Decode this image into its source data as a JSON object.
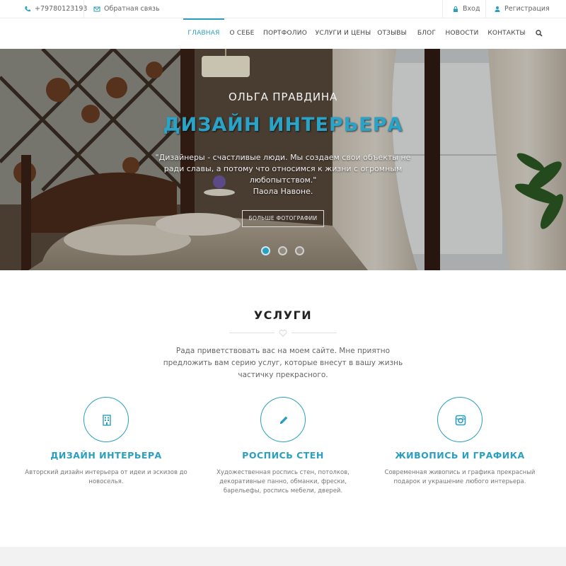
{
  "topbar": {
    "phone": "+79780123193",
    "feedback": "Обратная связь",
    "login": "Вход",
    "register": "Регистрация"
  },
  "nav": {
    "items": [
      {
        "label": "ГЛАВНАЯ",
        "active": true
      },
      {
        "label": "О СЕБЕ"
      },
      {
        "label": "ПОРТФОЛИО"
      },
      {
        "label": "УСЛУГИ И ЦЕНЫ"
      },
      {
        "label": "ОТЗЫВЫ"
      },
      {
        "label": "БЛОГ"
      },
      {
        "label": "НОВОСТИ"
      },
      {
        "label": "КОНТАКТЫ"
      }
    ],
    "search_icon": "search-icon"
  },
  "hero": {
    "subtitle": "ОЛЬГА ПРАВДИНА",
    "title": "ДИЗАЙН ИНТЕРЬЕРА",
    "quote": "\"Дизайнеры - счастливые люди. Мы создаем свои объекты не ради славы, а потому что относимся к жизни с огромным любопытством.\"",
    "author": "Паола Навоне.",
    "button": "БОЛЬШЕ ФОТОГРАФИИ",
    "slides": 3,
    "active_slide": 1
  },
  "services": {
    "title": "УСЛУГИ",
    "intro": "Рада приветствовать вас на моем сайте. Мне приятно предложить вам серию услуг, которые внесут в вашу жизнь частичку прекрасного.",
    "items": [
      {
        "title": "ДИЗАЙН ИНТЕРЬЕРА",
        "text": "Авторский дизайн интерьера от идеи и эскизов до новоселья.",
        "icon": "building-icon"
      },
      {
        "title": "РОСПИСЬ СТЕН",
        "text": "Художественная роспись стен, потолков, декоративные панно, обманки, фрески, барельефы, роспись мебели, дверей.",
        "icon": "pencil-icon"
      },
      {
        "title": "ЖИВОПИСЬ И ГРАФИКА",
        "text": "Современная живопись и графика прекрасный подарок и украшение любого интерьера.",
        "icon": "instagram-icon"
      }
    ]
  },
  "colors": {
    "accent": "#2a9fc0"
  }
}
